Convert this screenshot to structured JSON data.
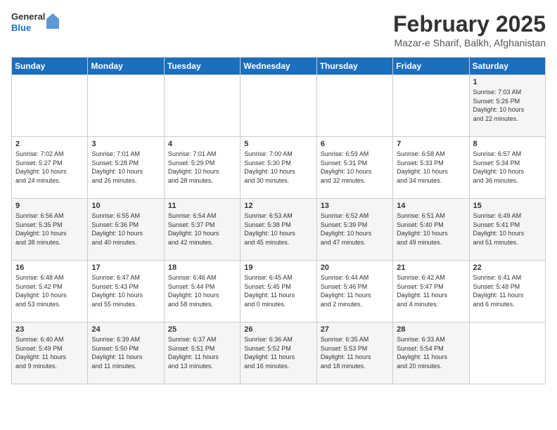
{
  "logo": {
    "general": "General",
    "blue": "Blue"
  },
  "header": {
    "month": "February 2025",
    "location": "Mazar-e Sharif, Balkh, Afghanistan"
  },
  "days_of_week": [
    "Sunday",
    "Monday",
    "Tuesday",
    "Wednesday",
    "Thursday",
    "Friday",
    "Saturday"
  ],
  "weeks": [
    [
      {
        "day": "",
        "info": ""
      },
      {
        "day": "",
        "info": ""
      },
      {
        "day": "",
        "info": ""
      },
      {
        "day": "",
        "info": ""
      },
      {
        "day": "",
        "info": ""
      },
      {
        "day": "",
        "info": ""
      },
      {
        "day": "1",
        "info": "Sunrise: 7:03 AM\nSunset: 5:26 PM\nDaylight: 10 hours\nand 22 minutes."
      }
    ],
    [
      {
        "day": "2",
        "info": "Sunrise: 7:02 AM\nSunset: 5:27 PM\nDaylight: 10 hours\nand 24 minutes."
      },
      {
        "day": "3",
        "info": "Sunrise: 7:01 AM\nSunset: 5:28 PM\nDaylight: 10 hours\nand 26 minutes."
      },
      {
        "day": "4",
        "info": "Sunrise: 7:01 AM\nSunset: 5:29 PM\nDaylight: 10 hours\nand 28 minutes."
      },
      {
        "day": "5",
        "info": "Sunrise: 7:00 AM\nSunset: 5:30 PM\nDaylight: 10 hours\nand 30 minutes."
      },
      {
        "day": "6",
        "info": "Sunrise: 6:59 AM\nSunset: 5:31 PM\nDaylight: 10 hours\nand 32 minutes."
      },
      {
        "day": "7",
        "info": "Sunrise: 6:58 AM\nSunset: 5:33 PM\nDaylight: 10 hours\nand 34 minutes."
      },
      {
        "day": "8",
        "info": "Sunrise: 6:57 AM\nSunset: 5:34 PM\nDaylight: 10 hours\nand 36 minutes."
      }
    ],
    [
      {
        "day": "9",
        "info": "Sunrise: 6:56 AM\nSunset: 5:35 PM\nDaylight: 10 hours\nand 38 minutes."
      },
      {
        "day": "10",
        "info": "Sunrise: 6:55 AM\nSunset: 5:36 PM\nDaylight: 10 hours\nand 40 minutes."
      },
      {
        "day": "11",
        "info": "Sunrise: 6:54 AM\nSunset: 5:37 PM\nDaylight: 10 hours\nand 42 minutes."
      },
      {
        "day": "12",
        "info": "Sunrise: 6:53 AM\nSunset: 5:38 PM\nDaylight: 10 hours\nand 45 minutes."
      },
      {
        "day": "13",
        "info": "Sunrise: 6:52 AM\nSunset: 5:39 PM\nDaylight: 10 hours\nand 47 minutes."
      },
      {
        "day": "14",
        "info": "Sunrise: 6:51 AM\nSunset: 5:40 PM\nDaylight: 10 hours\nand 49 minutes."
      },
      {
        "day": "15",
        "info": "Sunrise: 6:49 AM\nSunset: 5:41 PM\nDaylight: 10 hours\nand 51 minutes."
      }
    ],
    [
      {
        "day": "16",
        "info": "Sunrise: 6:48 AM\nSunset: 5:42 PM\nDaylight: 10 hours\nand 53 minutes."
      },
      {
        "day": "17",
        "info": "Sunrise: 6:47 AM\nSunset: 5:43 PM\nDaylight: 10 hours\nand 55 minutes."
      },
      {
        "day": "18",
        "info": "Sunrise: 6:46 AM\nSunset: 5:44 PM\nDaylight: 10 hours\nand 58 minutes."
      },
      {
        "day": "19",
        "info": "Sunrise: 6:45 AM\nSunset: 5:45 PM\nDaylight: 11 hours\nand 0 minutes."
      },
      {
        "day": "20",
        "info": "Sunrise: 6:44 AM\nSunset: 5:46 PM\nDaylight: 11 hours\nand 2 minutes."
      },
      {
        "day": "21",
        "info": "Sunrise: 6:42 AM\nSunset: 5:47 PM\nDaylight: 11 hours\nand 4 minutes."
      },
      {
        "day": "22",
        "info": "Sunrise: 6:41 AM\nSunset: 5:48 PM\nDaylight: 11 hours\nand 6 minutes."
      }
    ],
    [
      {
        "day": "23",
        "info": "Sunrise: 6:40 AM\nSunset: 5:49 PM\nDaylight: 11 hours\nand 9 minutes."
      },
      {
        "day": "24",
        "info": "Sunrise: 6:39 AM\nSunset: 5:50 PM\nDaylight: 11 hours\nand 11 minutes."
      },
      {
        "day": "25",
        "info": "Sunrise: 6:37 AM\nSunset: 5:51 PM\nDaylight: 11 hours\nand 13 minutes."
      },
      {
        "day": "26",
        "info": "Sunrise: 6:36 AM\nSunset: 5:52 PM\nDaylight: 11 hours\nand 16 minutes."
      },
      {
        "day": "27",
        "info": "Sunrise: 6:35 AM\nSunset: 5:53 PM\nDaylight: 11 hours\nand 18 minutes."
      },
      {
        "day": "28",
        "info": "Sunrise: 6:33 AM\nSunset: 5:54 PM\nDaylight: 11 hours\nand 20 minutes."
      },
      {
        "day": "",
        "info": ""
      }
    ]
  ]
}
